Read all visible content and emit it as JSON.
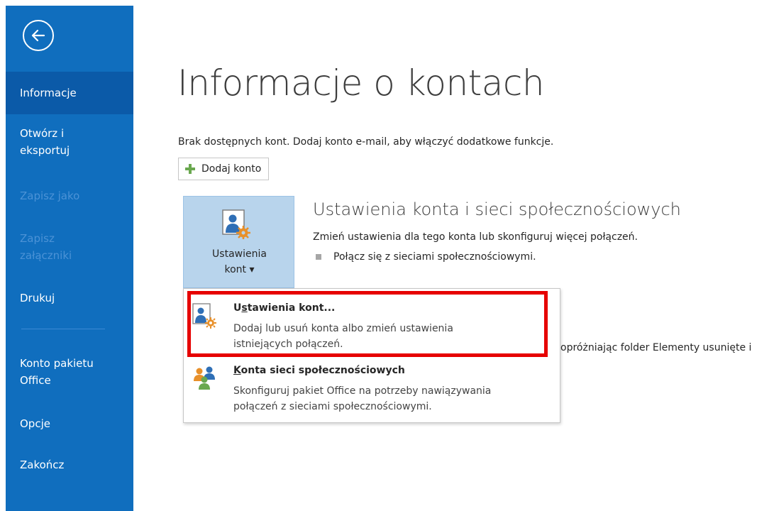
{
  "sidebar": {
    "items": [
      {
        "label": "Informacje"
      },
      {
        "label": "Otwórz i"
      },
      {
        "label": "eksportuj"
      },
      {
        "label": "Zapisz jako"
      },
      {
        "label": "Zapisz"
      },
      {
        "label": "załączniki"
      },
      {
        "label": "Drukuj"
      },
      {
        "label": "Konto pakietu"
      },
      {
        "label": "Office"
      },
      {
        "label": "Opcje"
      },
      {
        "label": "Zakończ"
      }
    ]
  },
  "main": {
    "title": "Informacje o kontach",
    "no_accounts_text": "Brak dostępnych kont. Dodaj konto e-mail, aby włączyć dodatkowe funkcje.",
    "add_account_label": "Dodaj konto",
    "account_settings_button": {
      "line1": "Ustawienia",
      "line2": "kont ▾"
    },
    "section_title": "Ustawienia konta i sieci społecznościowych",
    "section_desc": "Zmień ustawienia dla tego konta lub skonfiguruj więcej połączeń.",
    "section_bullet": "Połącz się z sieciami społecznościowymi.",
    "clipped_text": "opróżniając folder Elementy usunięte i"
  },
  "dropdown": {
    "item1": {
      "title_u": "s",
      "title_pre": "U",
      "title_post": "tawienia kont...",
      "desc_line1": "Dodaj lub usuń konta albo zmień ustawienia",
      "desc_line2": "istniejących połączeń."
    },
    "item2": {
      "title_u": "K",
      "title_post": "onta sieci społecznościowych",
      "desc_line1": "Skonfiguruj pakiet Office na potrzeby nawiązywania",
      "desc_line2": "połączeń z sieciami społecznościowymi."
    }
  },
  "colors": {
    "sidebar": "#106ebe",
    "sidebar_active": "#0b5aa8",
    "highlight": "#e60000",
    "accent_button": "#b8d4ec"
  }
}
